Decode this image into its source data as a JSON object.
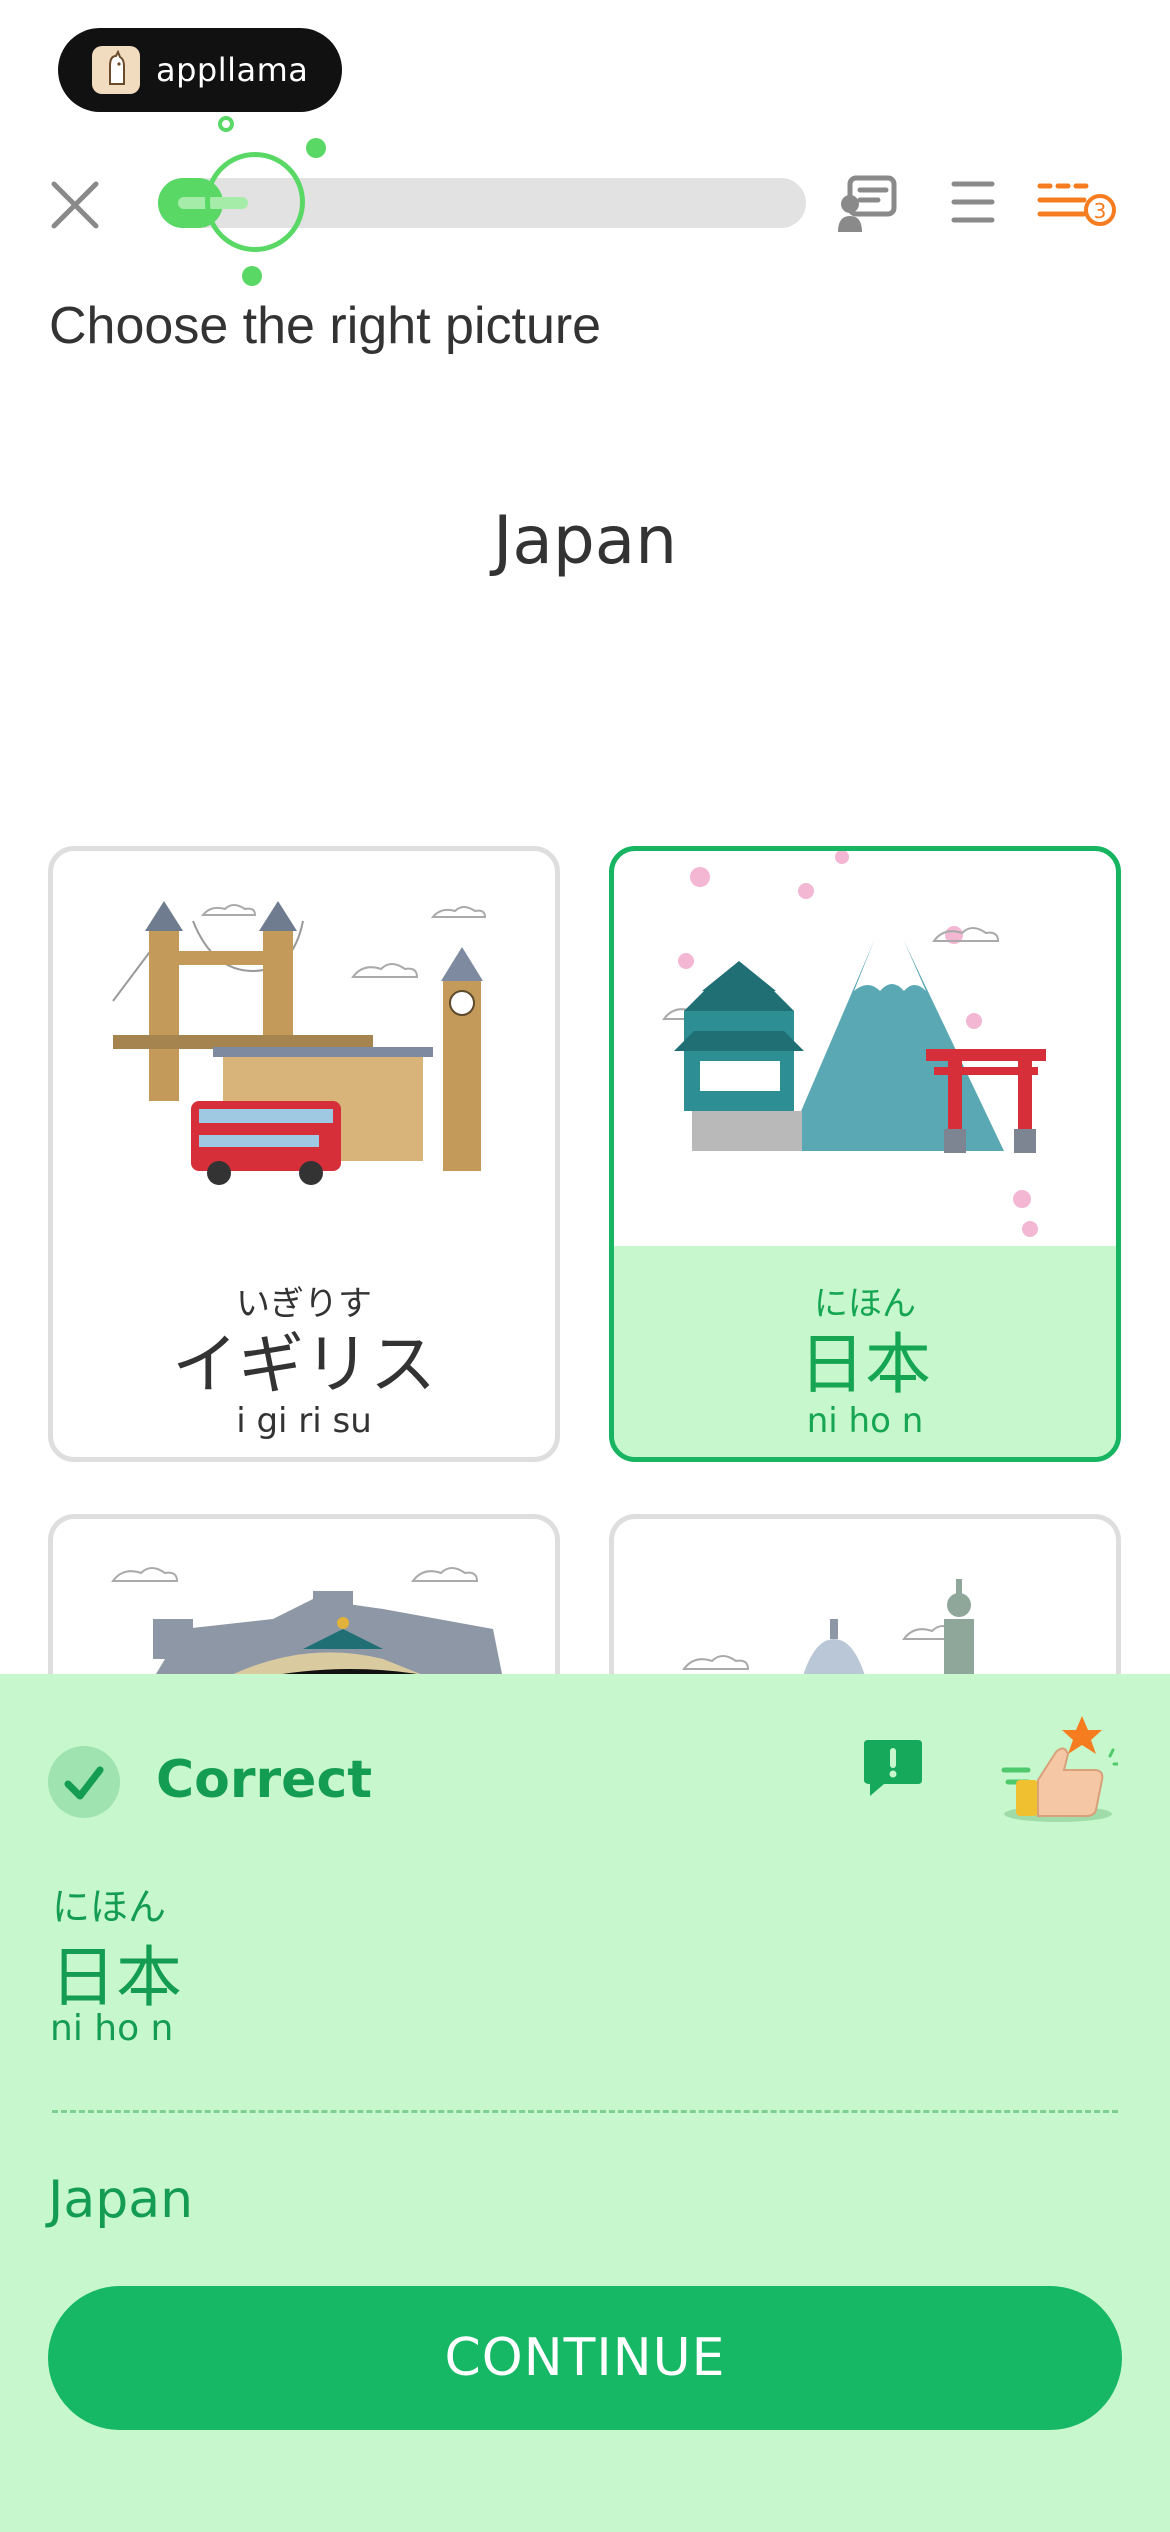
{
  "app_badge": {
    "name": "appllama",
    "icon": "llama-logo-icon"
  },
  "header": {
    "close_icon": "close-icon",
    "progress_fraction": 0.1,
    "tips_icon": "tips-icon",
    "menu_icon": "menu-icon",
    "streak_icon": "streak-icon",
    "streak_count": "3"
  },
  "prompt": {
    "instruction": "Choose the right picture",
    "word": "Japan"
  },
  "cards": [
    {
      "kana": "いぎりす",
      "kanji": "イギリス",
      "romaji": "i gi ri su",
      "selected": false,
      "illustration": "london-landmarks"
    },
    {
      "kana": "にほん",
      "kanji": "日本",
      "romaji": "ni ho n",
      "selected": true,
      "illustration": "japan-landmarks"
    },
    {
      "illustration": "china-landmarks",
      "selected": false
    },
    {
      "illustration": "usa-landmarks",
      "selected": false
    }
  ],
  "feedback": {
    "verdict": "Correct",
    "answer_kana": "にほん",
    "answer_kanji": "日本",
    "answer_romaji": "ni ho n",
    "translation": "Japan",
    "continue_label": "CONTINUE",
    "report_icon": "report-icon",
    "mascot_icon": "thumbs-up-icon"
  },
  "colors": {
    "accent_green": "#16b865",
    "feedback_bg": "#c7f7cc",
    "progress_green": "#59d866",
    "streak_orange": "#f57c1f"
  }
}
